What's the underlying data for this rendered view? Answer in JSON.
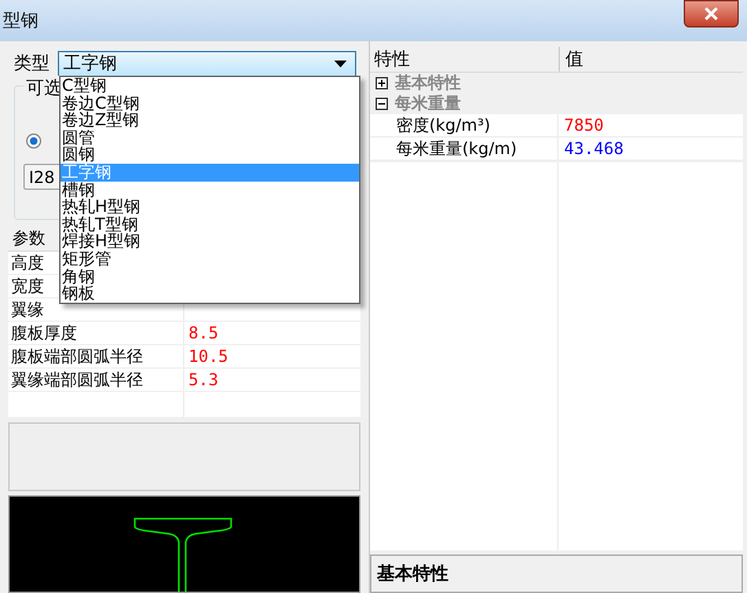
{
  "window": {
    "title": "型钢"
  },
  "type_selector": {
    "label": "类型",
    "value": "工字钢",
    "expanded": true,
    "options": [
      {
        "label": "C型钢",
        "selected": false
      },
      {
        "label": "卷边C型钢",
        "selected": false
      },
      {
        "label": "卷边Z型钢",
        "selected": false
      },
      {
        "label": "圆管",
        "selected": false
      },
      {
        "label": "圆钢",
        "selected": false
      },
      {
        "label": "工字钢",
        "selected": true
      },
      {
        "label": "槽钢",
        "selected": false
      },
      {
        "label": "热轧H型钢",
        "selected": false
      },
      {
        "label": "热轧T型钢",
        "selected": false
      },
      {
        "label": "焊接H型钢",
        "selected": false
      },
      {
        "label": "矩形管",
        "selected": false
      },
      {
        "label": "角钢",
        "selected": false
      },
      {
        "label": "钢板",
        "selected": false
      }
    ]
  },
  "options_group": {
    "label": "可选",
    "radio_checked": true,
    "spec_value": "I28"
  },
  "params_table": {
    "header": "参数",
    "rows": [
      {
        "name": "高度"
      },
      {
        "name": "宽度"
      },
      {
        "name": "翼缘"
      },
      {
        "name": "腹板厚度",
        "value": "8.5"
      },
      {
        "name": "腹板端部圆弧半径",
        "value": "10.5"
      },
      {
        "name": "翼缘端部圆弧半径",
        "value": "5.3"
      }
    ]
  },
  "property_grid": {
    "columns": [
      "特性",
      "值"
    ],
    "categories": [
      {
        "name": "基本特性",
        "expanded": false
      },
      {
        "name": "每米重量",
        "expanded": true,
        "children": [
          {
            "name": "密度(kg/m³)",
            "value": "7850",
            "color": "#ff0000"
          },
          {
            "name": "每米重量(kg/m)",
            "value": "43.468",
            "color": "#0000ff"
          }
        ]
      }
    ]
  },
  "description_pane": {
    "title": "基本特性"
  }
}
